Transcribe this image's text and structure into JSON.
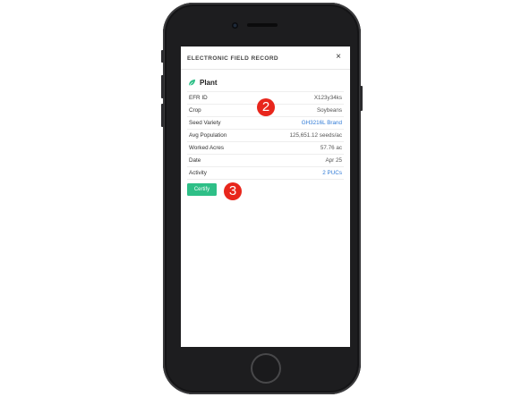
{
  "modal": {
    "title": "ELECTRONIC FIELD RECORD",
    "close_symbol": "×",
    "section_title": "Plant",
    "section_icon": "leaf-icon",
    "accent_color": "#2ebf87",
    "link_color": "#2f7ad6",
    "rows": [
      {
        "label": "EFR ID",
        "value": "X123y34ks"
      },
      {
        "label": "Crop",
        "value": "Soybeans"
      },
      {
        "label": "Seed Variety",
        "value": "GH3216L Brand"
      },
      {
        "label": "Avg Population",
        "value": "125,651.12 seeds/ac"
      },
      {
        "label": "Worked Acres",
        "value": "57.76 ac"
      },
      {
        "label": "Date",
        "value": "Apr 25"
      },
      {
        "label": "Activity",
        "value": "2 PUCs"
      }
    ],
    "certify_label": "Certify"
  },
  "annotations": {
    "marker_2": "2",
    "marker_3": "3",
    "marker_color": "#e8261c"
  }
}
